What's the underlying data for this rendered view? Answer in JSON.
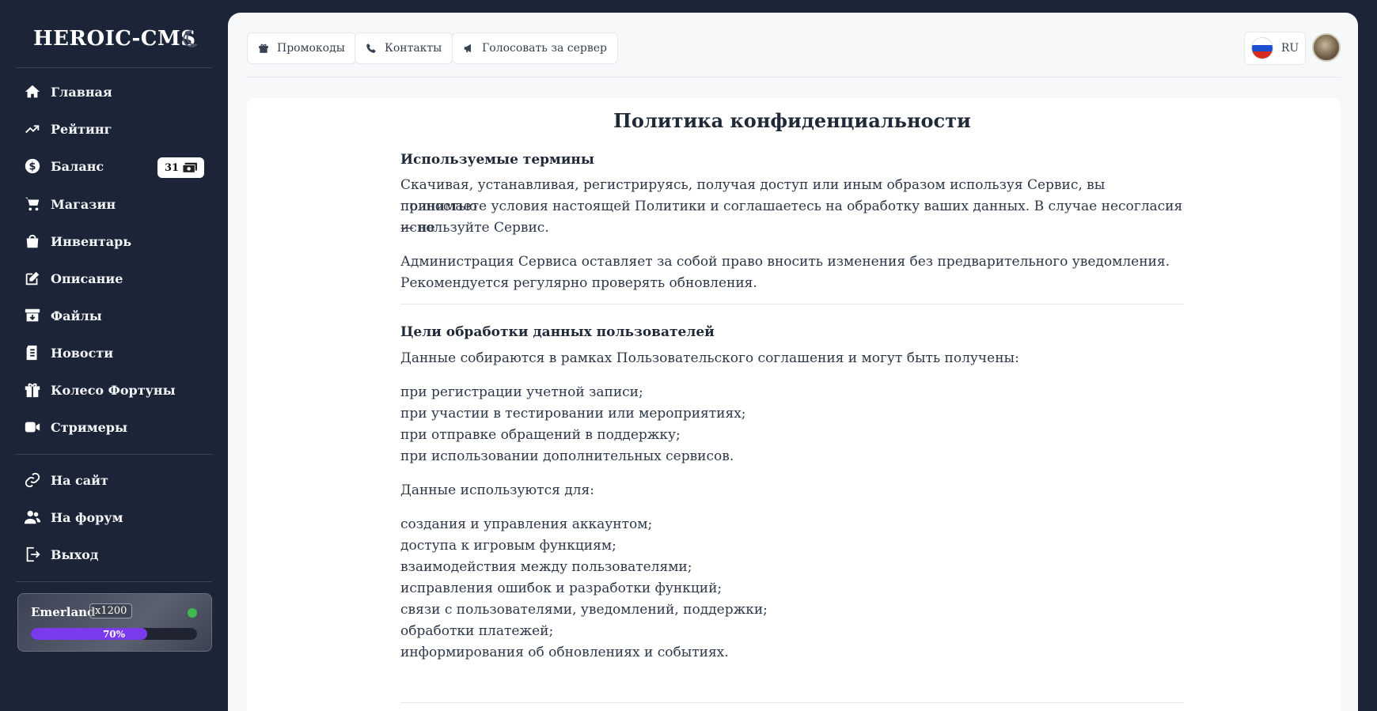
{
  "sidebar": {
    "brand": "HEROIC-CMS",
    "nav": [
      {
        "label": "Главная",
        "icon": "home-icon"
      },
      {
        "label": "Рейтинг",
        "icon": "trending-up-icon"
      },
      {
        "label": "Баланс",
        "icon": "dollar-circle-icon"
      },
      {
        "label": "Магазин",
        "icon": "cart-icon"
      },
      {
        "label": "Инвентарь",
        "icon": "shopping-bag-icon"
      },
      {
        "label": "Описание",
        "icon": "edit-icon"
      },
      {
        "label": "Файлы",
        "icon": "archive-icon"
      },
      {
        "label": "Новости",
        "icon": "newspaper-icon"
      },
      {
        "label": "Колесо Фортуны",
        "icon": "gift-icon"
      },
      {
        "label": "Стримеры",
        "icon": "video-icon"
      }
    ],
    "links": [
      {
        "label": "На сайт",
        "icon": "link-icon"
      },
      {
        "label": "На форум",
        "icon": "users-icon"
      },
      {
        "label": "Выход",
        "icon": "logout-icon"
      }
    ],
    "balance_value": "31",
    "server": {
      "name": "Emerland",
      "rate": "x1200",
      "progress_pct": 70,
      "progress_label": "70%",
      "status_color": "#3fb950"
    }
  },
  "topbar": {
    "buttons": [
      {
        "label": "Промокоды",
        "icon": "gift-icon"
      },
      {
        "label": "Контакты",
        "icon": "phone-icon"
      },
      {
        "label": "Голосовать за сервер",
        "icon": "megaphone-icon"
      }
    ],
    "lang": "RU"
  },
  "doc": {
    "title": "Политика конфиденциальности",
    "s1_heading": "Используемые термины",
    "s1_p1_l1": "Скачивая, устанавливая, регистрируясь, получая доступ или иным образом используя Сервис, вы полностью",
    "s1_p1_l2": "принимаете условия настоящей Политики и соглашаетесь на обработку ваших данных. В случае несогласия — не",
    "s1_p1_l3": "используйте Сервис.",
    "s1_p2_l1": "Администрация Сервиса оставляет за собой право вносить изменения без предварительного уведомления.",
    "s1_p2_l2": "Рекомендуется регулярно проверять обновления.",
    "s2_heading": "Цели обработки данных пользователей",
    "s2_intro": "Данные собираются в рамках Пользовательского соглашения и могут быть получены:",
    "s2_list1": [
      "при регистрации учетной записи;",
      "при участии в тестировании или мероприятиях;",
      "при отправке обращений в поддержку;",
      "при использовании дополнительных сервисов."
    ],
    "s2_intro2": "Данные используются для:",
    "s2_list2": [
      "создания и управления аккаунтом;",
      "доступа к игровым функциям;",
      "взаимодействия между пользователями;",
      "исправления ошибок и разработки функций;",
      "связи с пользователями, уведомлений, поддержки;",
      "обработки платежей;",
      "информирования об обновлениях и событиях."
    ]
  }
}
